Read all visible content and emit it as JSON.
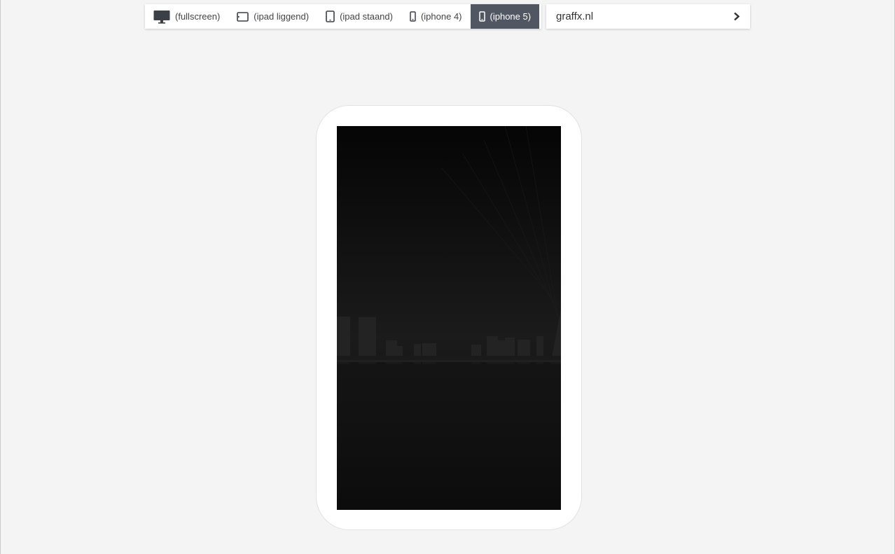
{
  "toolbar": {
    "devices": [
      {
        "label": "(fullscreen)",
        "icon": "desktop-icon",
        "active": false
      },
      {
        "label": "(ipad liggend)",
        "icon": "tablet-landscape-icon",
        "active": false
      },
      {
        "label": "(ipad staand)",
        "icon": "tablet-portrait-icon",
        "active": false
      },
      {
        "label": "(iphone 4)",
        "icon": "phone-small-icon",
        "active": false
      },
      {
        "label": "(iphone 5)",
        "icon": "phone-icon",
        "active": true
      }
    ]
  },
  "url_bar": {
    "url": "graffx.nl",
    "go_icon": "chevron-right-icon"
  },
  "colors": {
    "background": "#f4f4f4",
    "active_tab": "#505762",
    "toolbar": "#ffffff",
    "screen": "#050505"
  }
}
